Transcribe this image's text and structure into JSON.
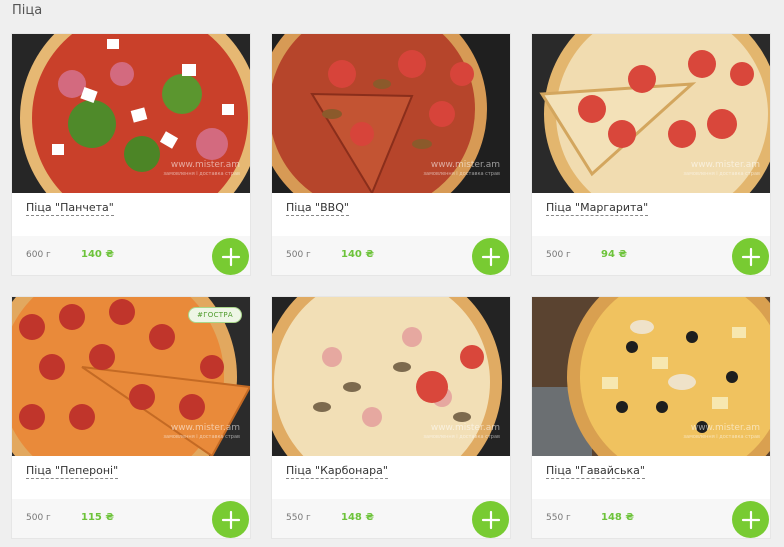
{
  "section": {
    "title": "Піца"
  },
  "products": [
    {
      "name": "Піца \"Панчета\"",
      "weight": "600 г",
      "price": "140 ₴",
      "badge": "",
      "watermark": "www.mister.am",
      "watermark_sub": "замовлення і доставка страв"
    },
    {
      "name": "Піца \"BBQ\"",
      "weight": "500 г",
      "price": "140 ₴",
      "badge": "",
      "watermark": "www.mister.am",
      "watermark_sub": "замовлення і доставка страв"
    },
    {
      "name": "Піца \"Маргарита\"",
      "weight": "500 г",
      "price": "94 ₴",
      "badge": "",
      "watermark": "www.mister.am",
      "watermark_sub": "замовлення і доставка страв"
    },
    {
      "name": "Піца \"Пепероні\"",
      "weight": "500 г",
      "price": "115 ₴",
      "badge": "#ГОСТРА",
      "watermark": "www.mister.am",
      "watermark_sub": "замовлення і доставка страв"
    },
    {
      "name": "Піца \"Карбонара\"",
      "weight": "550 г",
      "price": "148 ₴",
      "badge": "",
      "watermark": "www.mister.am",
      "watermark_sub": "замовлення і доставка страв"
    },
    {
      "name": "Піца \"Гавайська\"",
      "weight": "550 г",
      "price": "148 ₴",
      "badge": "",
      "watermark": "www.mister.am",
      "watermark_sub": "замовлення і доставка страв"
    }
  ],
  "icons": {
    "add": "plus-icon"
  },
  "colors": {
    "accent": "#78cb32",
    "price": "#6dc33a",
    "background": "#efefef"
  }
}
